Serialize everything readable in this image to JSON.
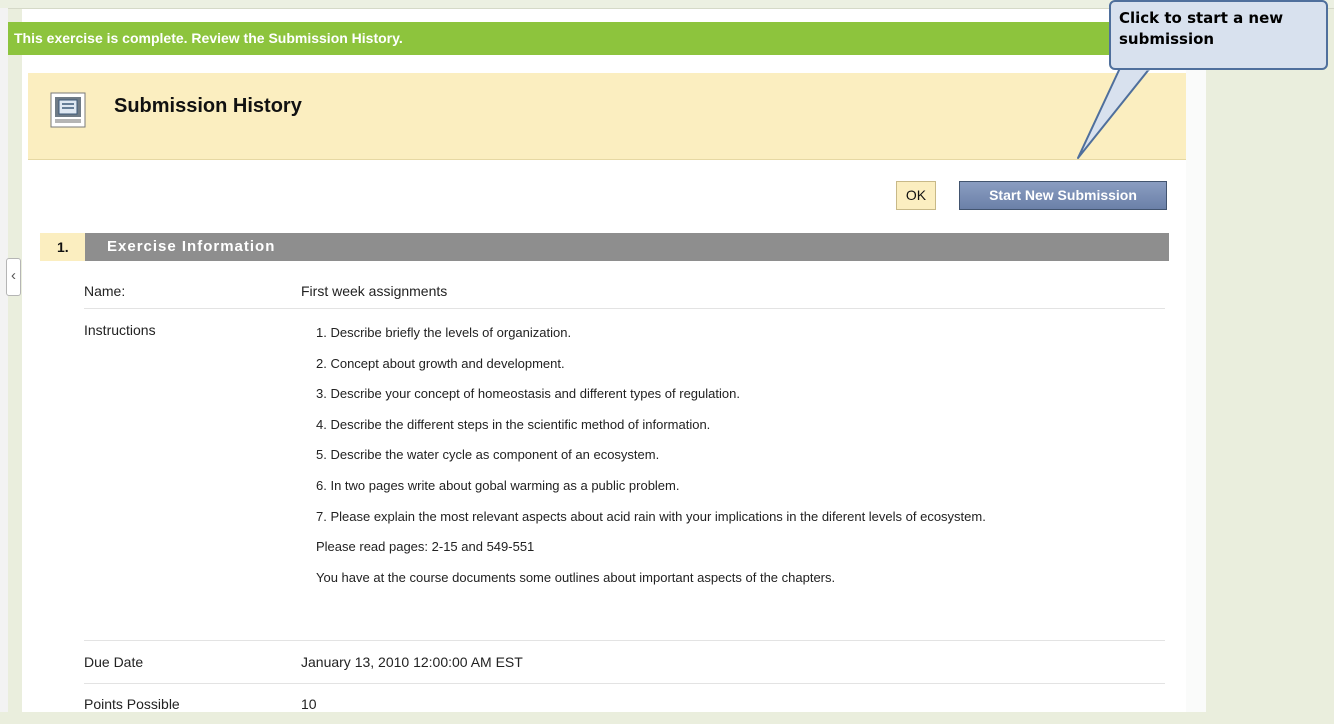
{
  "banner": {
    "text": "This exercise is complete. Review the Submission History."
  },
  "header": {
    "title": "Submission History",
    "icon": "submission-page-icon"
  },
  "buttons": {
    "ok_label": "OK",
    "start_label": "Start New Submission"
  },
  "section": {
    "number": "1.",
    "title": "Exercise Information"
  },
  "fields": {
    "name": {
      "label": "Name:",
      "value": "First week assignments"
    },
    "instructions": {
      "label": "Instructions",
      "items": [
        "1. Describe briefly the levels of organization.",
        "2. Concept about growth and development.",
        "3. Describe your concept of homeostasis and different types of regulation.",
        "4. Describe the different steps in the scientific method of information.",
        "5. Describe the water cycle as component of an ecosystem.",
        "6. In two pages write about gobal warming  as a public problem.",
        "7. Please explain the most relevant aspects  about acid rain with your  implications in the diferent levels of ecosystem.",
        "Please read pages: 2-15 and 549-551",
        "You have at the course documents some outlines about important aspects of the chapters."
      ]
    },
    "due_date": {
      "label": "Due Date",
      "value": "January 13, 2010 12:00:00 AM EST"
    },
    "points": {
      "label": "Points Possible",
      "value": "10"
    }
  },
  "callout": {
    "text": "Click to start a new submission"
  },
  "colors": {
    "banner": "#8dc43d",
    "header_bg": "#fbeec0",
    "section_bar": "#8e8e8e",
    "start_button": "#6b80a8",
    "callout_bg": "#d8e1ee"
  }
}
